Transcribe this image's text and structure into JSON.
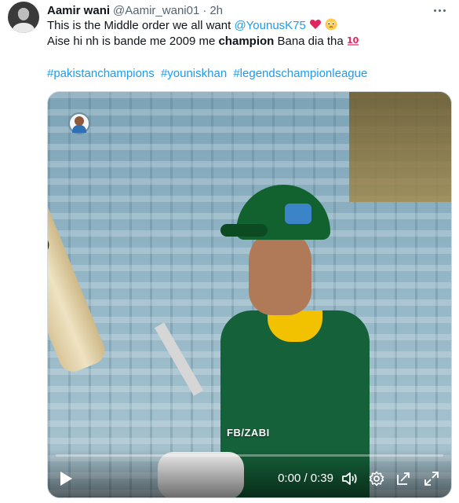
{
  "tweet": {
    "author_name": "Aamir wani",
    "author_handle": "@Aamir_wani01",
    "separator": "·",
    "time": "2h",
    "text_line1_a": "This is the Middle order we all want ",
    "mention": "@YounusK75",
    "text_line2_a": "Aise hi nh is bande me 2009 me ",
    "text_line2_bold": "champion",
    "text_line2_b": " Bana dia tha",
    "hashtags": [
      "#pakistanchampions",
      "#youniskhan",
      "#legendschampionleague"
    ]
  },
  "video": {
    "watermark": "FB/ZABI",
    "timecode": "0:00 / 0:39",
    "progress_fraction": 0
  },
  "icons": {
    "more": "more-options-icon",
    "heart": "red-heart-emoji",
    "smile": "pleading-face-emoji",
    "hundred": "hundred-points-emoji",
    "play": "play-icon",
    "volume": "volume-icon",
    "settings": "settings-gear-icon",
    "pip": "picture-in-picture-icon",
    "fullscreen": "fullscreen-icon"
  },
  "colors": {
    "link": "#1d9bf0",
    "text": "#0f1419",
    "muted": "#536471"
  }
}
